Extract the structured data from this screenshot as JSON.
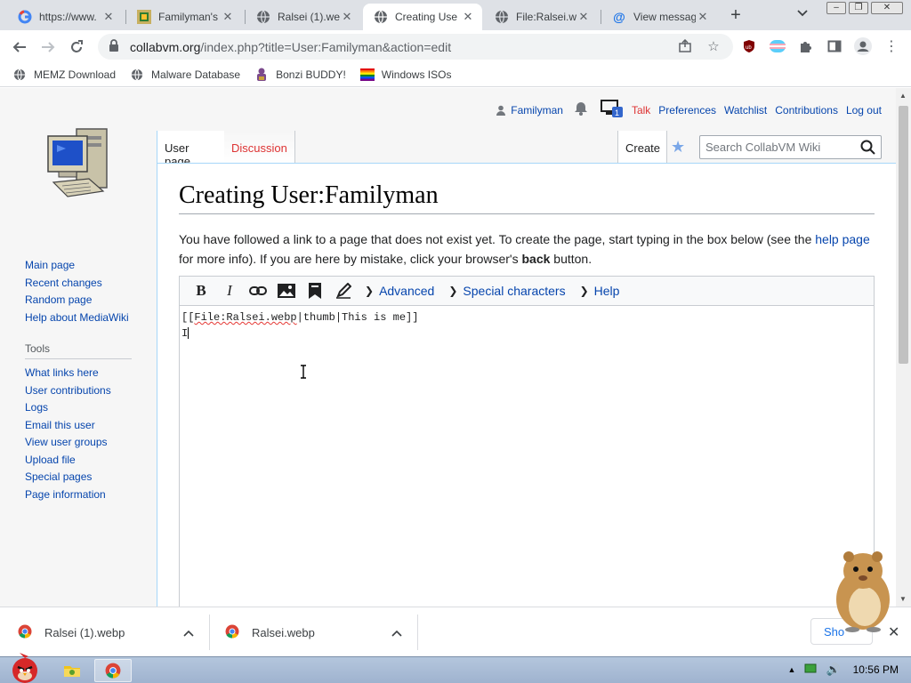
{
  "browser": {
    "tabs": [
      {
        "title": "https://www.",
        "favicon": "google-icon",
        "active": false
      },
      {
        "title": "Familyman's",
        "favicon": "pixel-art-icon",
        "active": false
      },
      {
        "title": "Ralsei (1).wel",
        "favicon": "globe-icon",
        "active": false
      },
      {
        "title": "Creating Use",
        "favicon": "globe-icon",
        "active": true
      },
      {
        "title": "File:Ralsei.we",
        "favicon": "globe-icon",
        "active": false
      },
      {
        "title": "View messag",
        "favicon": "at-icon",
        "active": false
      }
    ],
    "url_host": "collabvm.org",
    "url_path": "/index.php?title=User:Familyman&action=edit",
    "bookmarks": [
      {
        "label": "MEMZ Download",
        "icon": "globe-icon"
      },
      {
        "label": "Malware Database",
        "icon": "globe-icon"
      },
      {
        "label": "Bonzi BUDDY!",
        "icon": "bonzi-icon"
      },
      {
        "label": "Windows ISOs",
        "icon": "windows-flag-icon"
      }
    ]
  },
  "wiki": {
    "personal": {
      "username": "Familyman",
      "talk": "Talk",
      "preferences": "Preferences",
      "watchlist": "Watchlist",
      "contributions": "Contributions",
      "logout": "Log out"
    },
    "tabs": {
      "user_page": "User page",
      "discussion": "Discussion",
      "create": "Create"
    },
    "search_placeholder": "Search CollabVM Wiki",
    "nav": [
      "Main page",
      "Recent changes",
      "Random page",
      "Help about MediaWiki"
    ],
    "tools_heading": "Tools",
    "tools": [
      "What links here",
      "User contributions",
      "Logs",
      "Email this user",
      "View user groups",
      "Upload file",
      "Special pages",
      "Page information"
    ],
    "heading": "Creating User:Familyman",
    "intro_1": "You have followed a link to a page that does not exist yet. To create the page, start typing in the box below (see the ",
    "intro_link": "help page",
    "intro_2": " for more info). If you are here by mistake, click your browser's ",
    "intro_bold": "back",
    "intro_3": " button.",
    "toolbar": {
      "advanced": "Advanced",
      "special": "Special characters",
      "help": "Help"
    },
    "editor_line1_a": "[[",
    "editor_line1_spell": "File:Ralsei.webp",
    "editor_line1_b": "|thumb|This is me]]",
    "editor_line2": "I"
  },
  "downloads": {
    "items": [
      {
        "name": "Ralsei (1).webp"
      },
      {
        "name": "Ralsei.webp"
      }
    ],
    "show_all": "Sho"
  },
  "taskbar": {
    "time": "10:56 PM"
  }
}
